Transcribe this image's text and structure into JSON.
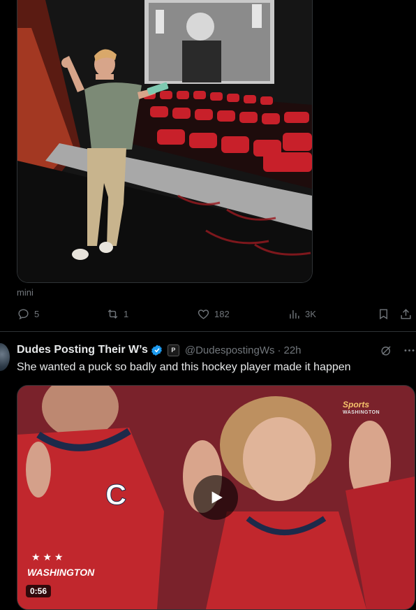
{
  "first_tweet": {
    "media_caption": "mini",
    "actions": {
      "replies": "5",
      "reposts": "1",
      "likes": "182",
      "views": "3K"
    }
  },
  "second_tweet": {
    "display_name": "Dudes Posting Their W’s",
    "affiliation_badge": "P",
    "handle": "@DudespostingWs",
    "separator": "·",
    "time": "22h",
    "text": "She wanted a puck so badly and this hockey player made it happen",
    "video": {
      "channel_logo": "Sports",
      "channel_sub": "WASHINGTON",
      "jersey_text": "WASHINGTON",
      "captain_letter": "C",
      "duration": "0:56"
    }
  },
  "colors": {
    "background": "#000000",
    "text": "#e7e9ea",
    "secondary_text": "#71767b",
    "verified": "#1d9bf0",
    "divider": "#2f3336"
  },
  "icons": [
    "reply-icon",
    "repost-icon",
    "like-icon",
    "views-icon",
    "bookmark-icon",
    "share-icon",
    "verified-icon",
    "grok-icon",
    "more-icon",
    "play-icon"
  ]
}
